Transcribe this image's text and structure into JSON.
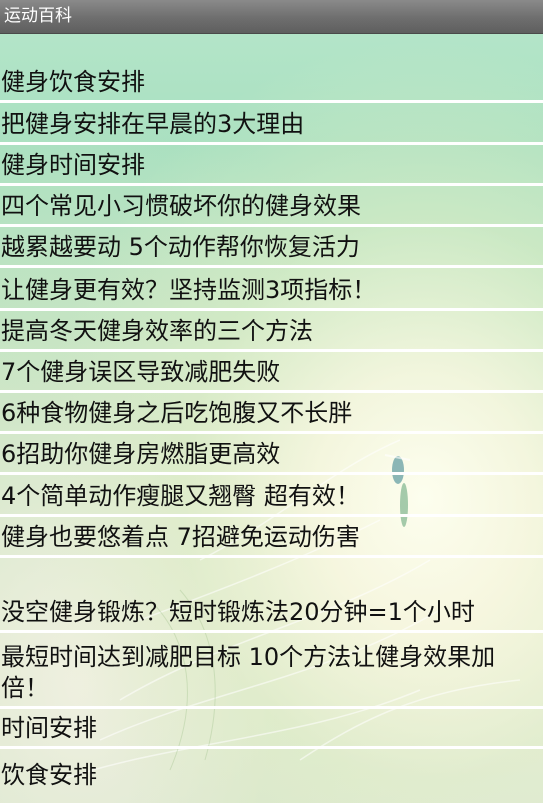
{
  "window": {
    "title": "运动百科"
  },
  "articles": [
    {
      "label": "健身饮食安排"
    },
    {
      "label": "把健身安排在早晨的3大理由"
    },
    {
      "label": "健身时间安排"
    },
    {
      "label": "四个常见小习惯破坏你的健身效果"
    },
    {
      "label": "越累越要动 5个动作帮你恢复活力"
    },
    {
      "label": "让健身更有效？坚持监测3项指标！"
    },
    {
      "label": "提高冬天健身效率的三个方法"
    },
    {
      "label": "7个健身误区导致减肥失败"
    },
    {
      "label": "6种食物健身之后吃饱腹又不长胖"
    },
    {
      "label": "6招助你健身房燃脂更高效"
    },
    {
      "label": "4个简单动作瘦腿又翘臀 超有效！"
    },
    {
      "label": "健身也要悠着点 7招避免运动伤害"
    },
    {
      "label": "没空健身锻炼？短时锻炼法20分钟=1个小时"
    },
    {
      "label": "最短时间达到减肥目标 10个方法让健身效果加倍！"
    },
    {
      "label": "时间安排"
    },
    {
      "label": "饮食安排"
    }
  ]
}
